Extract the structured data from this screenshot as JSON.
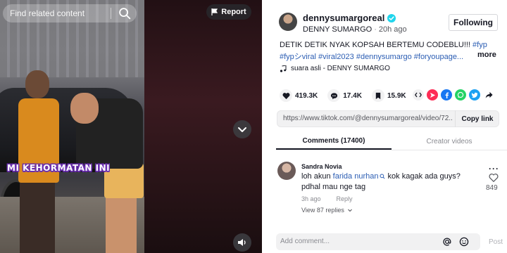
{
  "video": {
    "search_placeholder": "Find related content",
    "report_label": "Report",
    "caption_overlay": "MI KEHORMATAN INI",
    "icons": {
      "search": "search-icon",
      "flag": "flag-icon",
      "chevron": "chevron-down-icon",
      "volume": "volume-icon"
    }
  },
  "author": {
    "username": "dennysumargoreal",
    "display_name": "DENNY SUMARGO",
    "separator": "·",
    "posted_age": "20h ago",
    "follow_label": "Following"
  },
  "description": {
    "text": "DETIK DETIK NYAK KOPSAH BERTEMU CODEBLU!!! ",
    "tag_first": "#fyp",
    "line2": "#fypシviral #viral2023 #dennysumargo #foryoupage...",
    "more_label": "more"
  },
  "music": {
    "label": "suara asli - DENNY SUMARGO"
  },
  "stats": {
    "likes": "419.3K",
    "comments": "17.4K",
    "saves": "15.9K"
  },
  "share_colors": {
    "embed": "#161823",
    "send": "#fe2c55",
    "facebook": "#1877f2",
    "whatsapp": "#25d366",
    "twitter": "#1da1f2",
    "share": "#161823"
  },
  "link": {
    "url": "https://www.tiktok.com/@dennysumargoreal/video/72...",
    "copy_label": "Copy link"
  },
  "tabs": [
    {
      "label": "Comments (17400)"
    },
    {
      "label": "Creator videos"
    }
  ],
  "comment": {
    "name": "Sandra Novia",
    "text_before": "loh akun ",
    "mention": "farida nurhan",
    "text_after": " kok kagak ada guys?",
    "text_line2": "pdhal mau nge tag",
    "age": "3h ago",
    "reply_label": "Reply",
    "replies_label": "View 87 replies",
    "likes": "849",
    "more": "···"
  },
  "composer": {
    "placeholder": "Add comment...",
    "post_label": "Post"
  }
}
